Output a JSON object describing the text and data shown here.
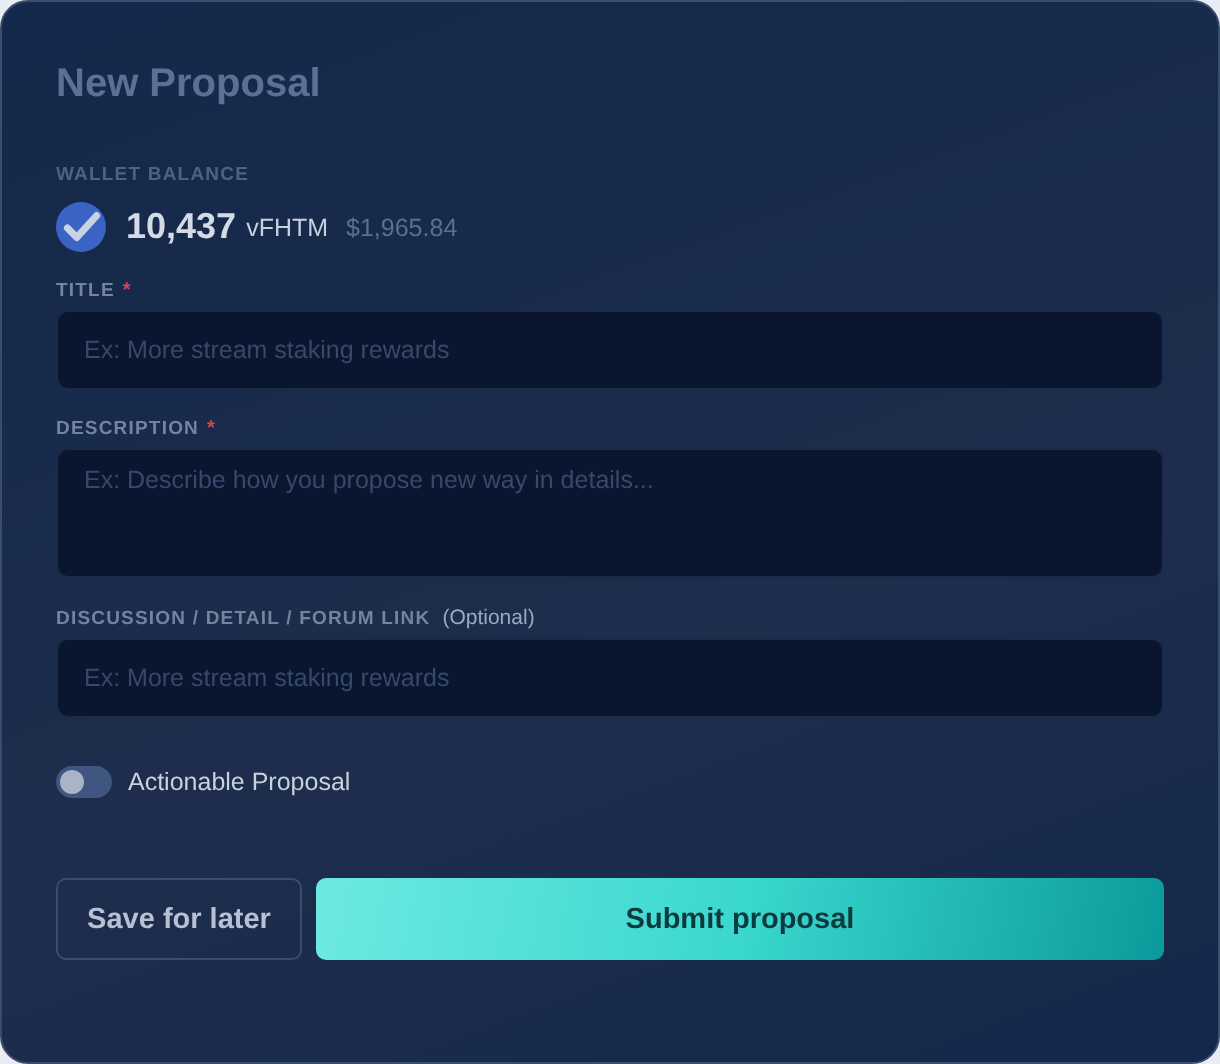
{
  "title": "New Proposal",
  "wallet": {
    "label": "WALLET BALANCE",
    "amount": "10,437",
    "unit": "vFHTM",
    "usd": "$1,965.84"
  },
  "fields": [
    {
      "label": "TITLE",
      "required_mark": "*",
      "placeholder": "Ex: More stream staking rewards",
      "kind": "input"
    },
    {
      "label": "DESCRIPTION",
      "required_mark": "*",
      "placeholder": "Ex: Describe how you propose new way in details...",
      "kind": "textarea"
    },
    {
      "label": "DISCUSSION / DETAIL / FORUM LINK",
      "hint": "(Optional)",
      "placeholder": "Ex: More stream staking rewards",
      "kind": "input"
    }
  ],
  "toggle": {
    "label": "Actionable Proposal",
    "on": false
  },
  "buttons": [
    {
      "label": "Save for later",
      "kind": "secondary"
    },
    {
      "label": "Submit proposal",
      "kind": "primary"
    }
  ]
}
